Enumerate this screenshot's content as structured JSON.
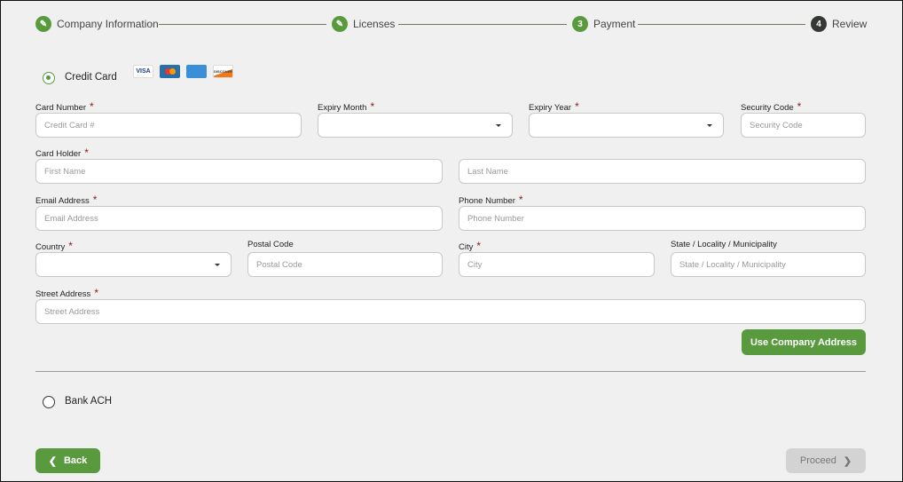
{
  "stepper": [
    {
      "label": "Company Information",
      "state": "done",
      "icon": "pencil-icon"
    },
    {
      "label": "Licenses",
      "state": "done",
      "icon": "pencil-icon"
    },
    {
      "label": "Payment",
      "number": "3",
      "state": "active"
    },
    {
      "label": "Review",
      "number": "4",
      "state": "pending"
    }
  ],
  "payment_methods": {
    "credit_card": "Credit Card",
    "bank_ach": "Bank ACH",
    "selected": "credit_card"
  },
  "card_logos": [
    "VISA",
    "MasterCard",
    "American Express",
    "DISCOVER"
  ],
  "fields": {
    "card_number": {
      "label": "Card Number",
      "placeholder": "Credit Card #"
    },
    "expiry_month": {
      "label": "Expiry Month",
      "value": ""
    },
    "expiry_year": {
      "label": "Expiry Year",
      "value": ""
    },
    "security_code": {
      "label": "Security Code",
      "placeholder": "Security Code"
    },
    "card_holder": {
      "label": "Card Holder",
      "first_placeholder": "First Name",
      "last_placeholder": "Last Name"
    },
    "email": {
      "label": "Email Address",
      "placeholder": "Email Address"
    },
    "phone": {
      "label": "Phone Number",
      "placeholder": "Phone Number"
    },
    "country": {
      "label": "Country",
      "value": ""
    },
    "postal": {
      "label": "Postal Code",
      "placeholder": "Postal Code"
    },
    "city": {
      "label": "City",
      "placeholder": "City"
    },
    "state": {
      "label": "State / Locality / Municipality",
      "placeholder": "State / Locality / Municipality"
    },
    "street": {
      "label": "Street Address",
      "placeholder": "Street Address"
    }
  },
  "required_mark": "*",
  "buttons": {
    "use_company_address": "Use Company Address",
    "back": "Back",
    "proceed": "Proceed"
  },
  "colors": {
    "accent": "#5a9a3f",
    "dark_step": "#343a33",
    "required": "#8b1a1a",
    "disabled": "#d3d3d3"
  }
}
